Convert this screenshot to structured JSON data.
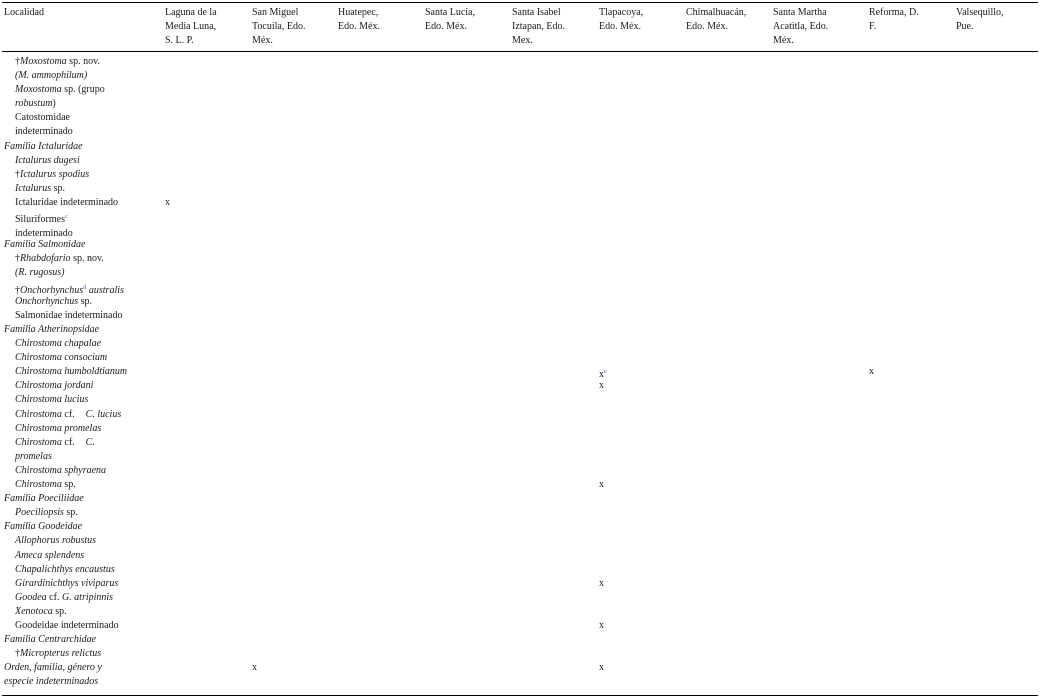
{
  "table": {
    "columns": [
      [
        "Localidad"
      ],
      [
        "Laguna de la",
        "Media Luna,",
        "S. L. P."
      ],
      [
        "San Miguel",
        "Tocuila, Edo.",
        "Méx."
      ],
      [
        "Huatepec,",
        "Edo. Méx."
      ],
      [
        "Santa Lucía,",
        "Edo. Méx."
      ],
      [
        "Santa Isabel",
        "Iztapan, Edo.",
        "Mex."
      ],
      [
        "Tlapacoya,",
        "Edo. Méx."
      ],
      [
        "Chimalhuacán,",
        "Edo. Méx."
      ],
      [
        "Santa Martha",
        "Acatitla, Edo.",
        "Méx."
      ],
      [
        "Reforma, D.",
        "F."
      ],
      [
        "Valsequillo,",
        "Pue."
      ]
    ],
    "rows": [
      {
        "ind": 1,
        "lines": [
          [
            {
              "t": "†"
            },
            {
              "t": "Moxostoma",
              "i": true
            },
            {
              "t": " sp. nov."
            }
          ],
          [
            {
              "t": "(M. ammophilum)",
              "i": true
            }
          ]
        ],
        "marks": []
      },
      {
        "ind": 1,
        "lines": [
          [
            {
              "t": "Moxostoma",
              "i": true
            },
            {
              "t": " sp. (grupo"
            }
          ],
          [
            {
              "t": "robustum",
              "i": true
            },
            {
              "t": ")"
            }
          ]
        ],
        "marks": []
      },
      {
        "ind": 1,
        "lines": [
          [
            {
              "t": "Catostomidae"
            }
          ],
          [
            {
              "t": "indeterminado"
            }
          ]
        ],
        "marks": []
      },
      {
        "ind": 0,
        "lines": [
          [
            {
              "t": "Familia Ictaluridae",
              "i": true
            }
          ]
        ],
        "marks": []
      },
      {
        "ind": 1,
        "lines": [
          [
            {
              "t": "Ictalurus dugesi",
              "i": true
            }
          ]
        ],
        "marks": []
      },
      {
        "ind": 1,
        "lines": [
          [
            {
              "t": "†"
            },
            {
              "t": "Ictalurus spodius",
              "i": true
            }
          ]
        ],
        "marks": []
      },
      {
        "ind": 1,
        "lines": [
          [
            {
              "t": "Ictalurus",
              "i": true
            },
            {
              "t": " sp."
            }
          ]
        ],
        "marks": []
      },
      {
        "ind": 1,
        "lines": [
          [
            {
              "t": "Ictaluridae indeterminado"
            }
          ]
        ],
        "marks": [
          [
            1,
            "x",
            ""
          ]
        ]
      },
      {
        "ind": 1,
        "lines": [
          [
            {
              "t": "Siluriformes"
            },
            {
              "t": "c",
              "sup": true
            }
          ],
          [
            {
              "t": "indeterminado"
            }
          ]
        ],
        "marks": []
      },
      {
        "ind": 0,
        "lines": [
          [
            {
              "t": "Familia Salmonidae",
              "i": true
            }
          ]
        ],
        "marks": []
      },
      {
        "ind": 1,
        "lines": [
          [
            {
              "t": "†"
            },
            {
              "t": "Rhabdofario",
              "i": true
            },
            {
              "t": " sp. nov."
            }
          ],
          [
            {
              "t": "(R. rugosus)",
              "i": true
            }
          ]
        ],
        "marks": []
      },
      {
        "ind": 1,
        "lines": [
          [
            {
              "t": "†"
            },
            {
              "t": "Onchorhynchus",
              "i": true
            },
            {
              "t": "d",
              "sup": true
            },
            {
              "t": " australis",
              "i": true
            }
          ]
        ],
        "marks": []
      },
      {
        "ind": 1,
        "lines": [
          [
            {
              "t": "Onchorhynchus",
              "i": true
            },
            {
              "t": " sp."
            }
          ]
        ],
        "marks": []
      },
      {
        "ind": 1,
        "lines": [
          [
            {
              "t": "Salmonidae indeterminado"
            }
          ]
        ],
        "marks": []
      },
      {
        "ind": 0,
        "lines": [
          [
            {
              "t": "Familia Atherinopsidae",
              "i": true
            }
          ]
        ],
        "marks": []
      },
      {
        "ind": 1,
        "lines": [
          [
            {
              "t": "Chirostoma chapalae",
              "i": true
            }
          ]
        ],
        "marks": []
      },
      {
        "ind": 1,
        "lines": [
          [
            {
              "t": "Chirostoma consocium",
              "i": true
            }
          ]
        ],
        "marks": []
      },
      {
        "ind": 1,
        "lines": [
          [
            {
              "t": "Chirostoma humboldtianum",
              "i": true
            }
          ]
        ],
        "marks": [
          [
            6,
            "x",
            "e"
          ],
          [
            9,
            "x",
            ""
          ]
        ]
      },
      {
        "ind": 1,
        "lines": [
          [
            {
              "t": "Chirostoma jordani",
              "i": true
            }
          ]
        ],
        "marks": [
          [
            6,
            "x",
            ""
          ]
        ]
      },
      {
        "ind": 1,
        "lines": [
          [
            {
              "t": "Chirostoma lucius",
              "i": true
            }
          ]
        ],
        "marks": []
      },
      {
        "ind": 1,
        "lines": [
          [
            {
              "t": "Chirostoma",
              "i": true
            },
            {
              "t": " cf."
            },
            {
              "sp": true
            },
            {
              "t": "C. lucius",
              "i": true
            }
          ]
        ],
        "marks": []
      },
      {
        "ind": 1,
        "lines": [
          [
            {
              "t": "Chirostoma promelas",
              "i": true
            }
          ]
        ],
        "marks": []
      },
      {
        "ind": 1,
        "lines": [
          [
            {
              "t": "Chirostoma",
              "i": true
            },
            {
              "t": " cf."
            },
            {
              "sp": true
            },
            {
              "t": "C.",
              "i": true
            }
          ],
          [
            {
              "t": "promelas",
              "i": true
            }
          ]
        ],
        "marks": []
      },
      {
        "ind": 1,
        "lines": [
          [
            {
              "t": "Chirostoma sphyraena",
              "i": true
            }
          ]
        ],
        "marks": []
      },
      {
        "ind": 1,
        "lines": [
          [
            {
              "t": "Chirostoma",
              "i": true
            },
            {
              "t": " sp."
            }
          ]
        ],
        "marks": [
          [
            6,
            "x",
            ""
          ]
        ]
      },
      {
        "ind": 0,
        "lines": [
          [
            {
              "t": "Familia Poeciliidae",
              "i": true
            }
          ]
        ],
        "marks": []
      },
      {
        "ind": 1,
        "lines": [
          [
            {
              "t": "Poeciliopsis",
              "i": true
            },
            {
              "t": " sp."
            }
          ]
        ],
        "marks": []
      },
      {
        "ind": 0,
        "lines": [
          [
            {
              "t": "Familia Goodeidae",
              "i": true
            }
          ]
        ],
        "marks": []
      },
      {
        "ind": 1,
        "lines": [
          [
            {
              "t": "Allophorus robustus",
              "i": true
            }
          ]
        ],
        "marks": []
      },
      {
        "ind": 1,
        "lines": [
          [
            {
              "t": "Ameca splendens",
              "i": true
            }
          ]
        ],
        "marks": []
      },
      {
        "ind": 1,
        "lines": [
          [
            {
              "t": "Chapalichthys encaustus",
              "i": true
            }
          ]
        ],
        "marks": []
      },
      {
        "ind": 1,
        "lines": [
          [
            {
              "t": "Girardinichthys viviparus",
              "i": true
            }
          ]
        ],
        "marks": [
          [
            6,
            "x",
            ""
          ]
        ]
      },
      {
        "ind": 1,
        "lines": [
          [
            {
              "t": "Goodea",
              "i": true
            },
            {
              "t": " cf. "
            },
            {
              "t": "G. atripinnis",
              "i": true
            }
          ]
        ],
        "marks": []
      },
      {
        "ind": 1,
        "lines": [
          [
            {
              "t": "Xenotoca",
              "i": true
            },
            {
              "t": " sp."
            }
          ]
        ],
        "marks": []
      },
      {
        "ind": 1,
        "lines": [
          [
            {
              "t": "Goodeidae indeterminado"
            }
          ]
        ],
        "marks": [
          [
            6,
            "x",
            ""
          ]
        ]
      },
      {
        "ind": 0,
        "lines": [
          [
            {
              "t": "Familia Centrarchidae",
              "i": true
            }
          ]
        ],
        "marks": []
      },
      {
        "ind": 1,
        "lines": [
          [
            {
              "t": "†"
            },
            {
              "t": "Micropterus relictus",
              "i": true
            }
          ]
        ],
        "marks": []
      },
      {
        "ind": 0,
        "lines": [
          [
            {
              "t": "Orden, familia, género y",
              "i": true
            }
          ],
          [
            {
              "t": "especie indeterminados",
              "i": true
            }
          ]
        ],
        "marks": [
          [
            2,
            "x",
            ""
          ],
          [
            6,
            "x",
            ""
          ]
        ]
      }
    ]
  },
  "colors": {
    "text": "#1a1a1a",
    "rule": "#000000",
    "footnote_ref": "#6a6aa0"
  }
}
